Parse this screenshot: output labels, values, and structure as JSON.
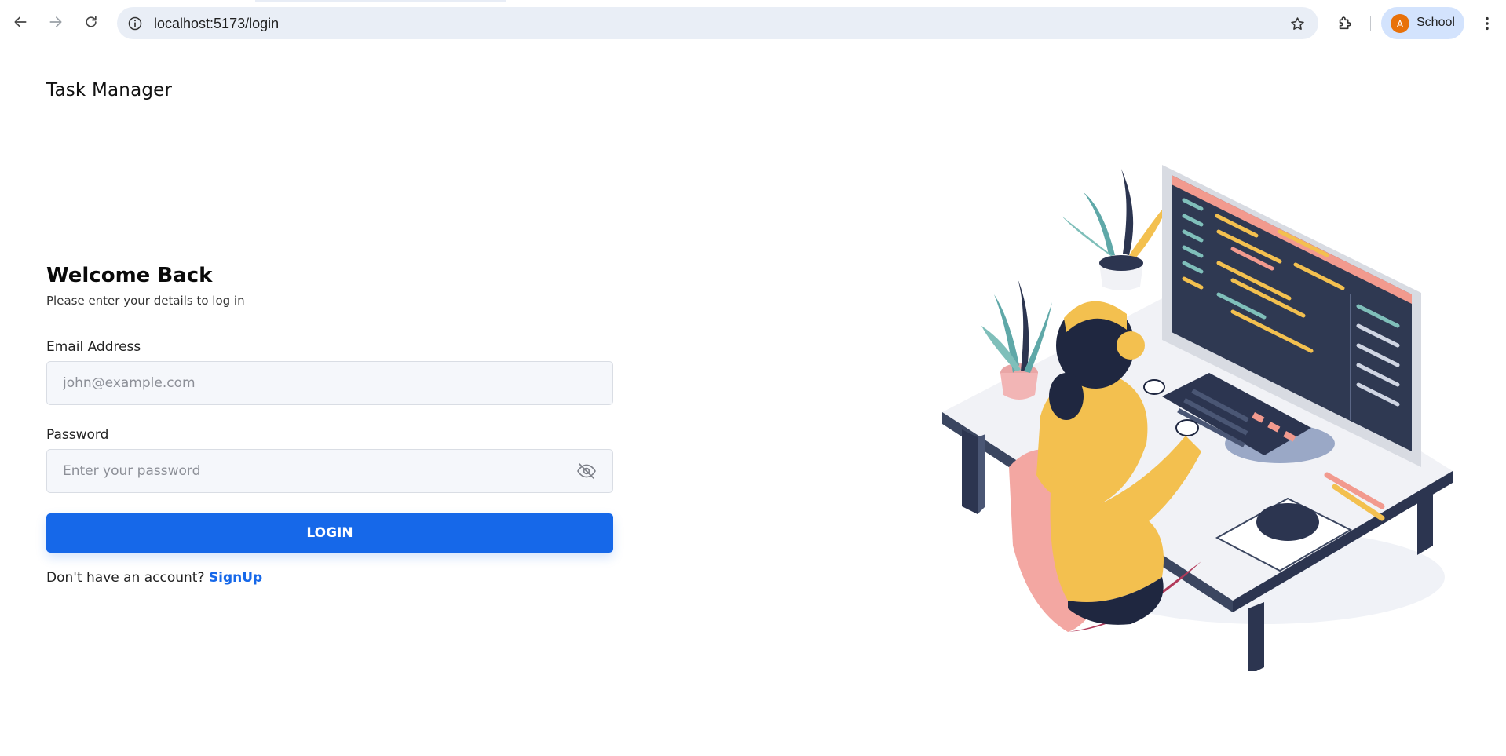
{
  "browser": {
    "url": "localhost:5173/login",
    "profile": {
      "initial": "A",
      "name": "School",
      "avatar_color": "#e8710a"
    }
  },
  "page": {
    "app_title": "Task Manager",
    "heading": "Welcome Back",
    "subtitle": "Please enter your details to log in",
    "email": {
      "label": "Email Address",
      "placeholder": "john@example.com",
      "value": ""
    },
    "password": {
      "label": "Password",
      "placeholder": "Enter your password",
      "value": "",
      "visibility_icon": "eye-off-icon"
    },
    "login_label": "LOGIN",
    "signup_prompt": "Don't have an account?",
    "signup_link": "SignUp",
    "accent_color": "#1668e9"
  }
}
